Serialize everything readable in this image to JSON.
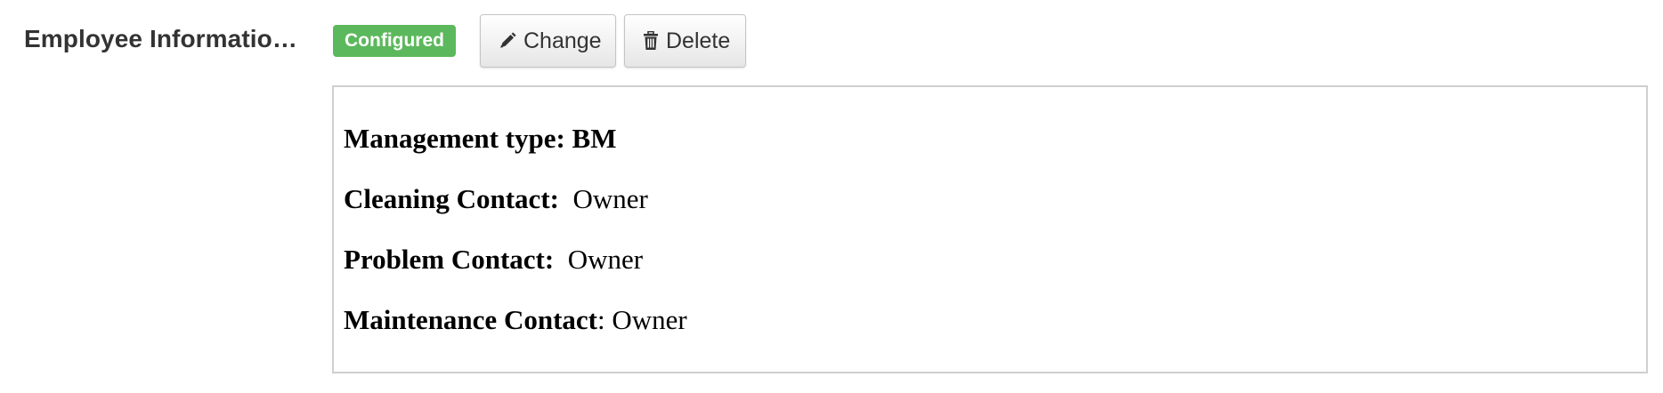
{
  "field": {
    "label": "Employee Informatio…"
  },
  "status": {
    "badge": "Configured",
    "color": "#5cb85c"
  },
  "buttons": {
    "change_label": "Change",
    "change_icon": "pencil-icon",
    "delete_label": "Delete",
    "delete_icon": "trash-icon"
  },
  "info": {
    "management": {
      "label": "Management type: BM",
      "value": ""
    },
    "cleaning": {
      "label": "Cleaning Contact:",
      "value": "Owner"
    },
    "problem": {
      "label": "Problem Contact:",
      "value": "Owner"
    },
    "maintenance": {
      "label": "Maintenance Contact",
      "suffix": ":",
      "value": "Owner"
    }
  }
}
